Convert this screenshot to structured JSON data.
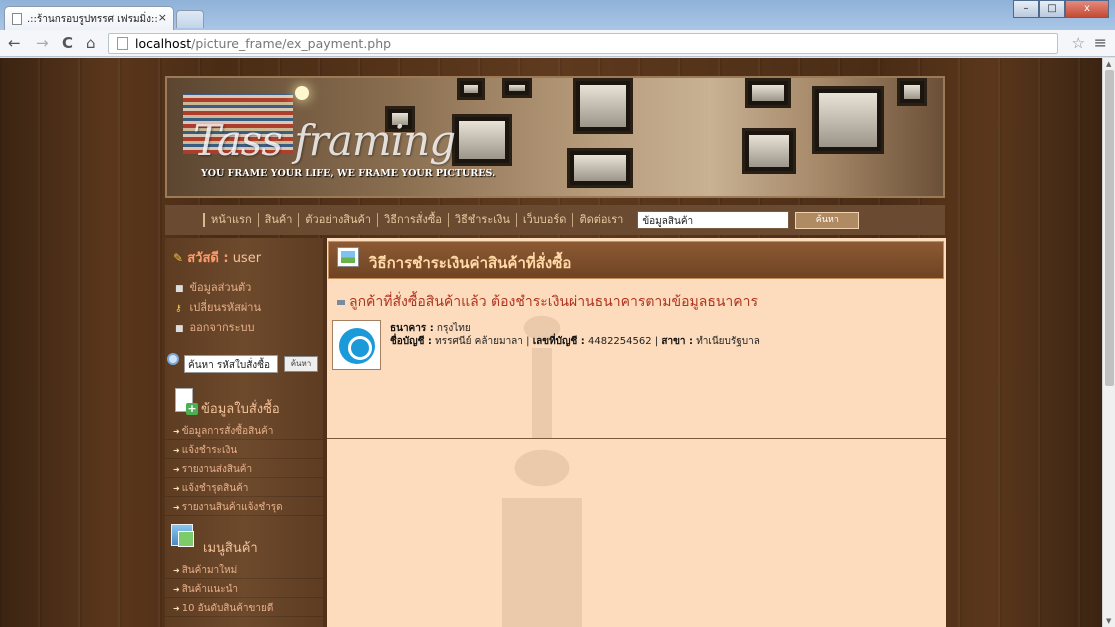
{
  "browser": {
    "tab_title": ".::ร้านกรอบรูปทรรศ เฟรมมิ่ง::",
    "tab_close": "×",
    "url_host": "localhost",
    "url_path": "/picture_frame/ex_payment.php",
    "back": "←",
    "forward": "→",
    "reload": "C",
    "home": "⌂",
    "star": "☆",
    "menu": "≡",
    "win_min": "–",
    "win_max": "□",
    "win_close": "x"
  },
  "banner": {
    "brand": "Tass framing",
    "tagline": "YOU FRAME YOUR LIFE, WE FRAME YOUR PICTURES."
  },
  "nav": {
    "items": [
      "หน้าแรก",
      "สินค้า",
      "ตัวอย่างสินค้า",
      "วิธีการสั่งซื้อ",
      "วิธีชำระเงิน",
      "เว็บบอร์ด",
      "ติดต่อเรา"
    ],
    "search_value": "ข้อมูลสินค้า",
    "search_button": "ค้นหา"
  },
  "sidebar": {
    "greeting_prefix": "สวัสดี :",
    "username": "user",
    "links": [
      "ข้อมูลส่วนตัว",
      "เปลี่ยนรหัสผ่าน",
      "ออกจากระบบ"
    ],
    "order_search_value": "ค้นหา รหัสใบสั่งซื้อ",
    "order_search_button": "ค้นหา",
    "order_section_title": "ข้อมูลใบสั่งซื้อ",
    "order_items": [
      "ข้อมูลการสั่งซื้อสินค้า",
      "แจ้งชำระเงิน",
      "รายงานส่งสินค้า",
      "แจ้งชำรุดสินค้า",
      "รายงานสินค้าแจ้งชำรุด"
    ],
    "product_section_title": "เมนูสินค้า",
    "product_items": [
      "สินค้ามาใหม่",
      "สินค้าแนะนำ",
      "10 อันดับสินค้าขายดี"
    ]
  },
  "content": {
    "title": "วิธีการชำระเงินค่าสินค้าที่สั่งซื้อ",
    "subtitle": "ลูกค้าที่สั่งซื้อสินค้าแล้ว ต้องชำระเงินผ่านธนาคารตามข้อมูลธนาคาร",
    "bank_label": "ธนาคาร :",
    "bank_name": "กรุงไทย",
    "account_name_label": "ชื่อบัญชี :",
    "account_name": "ทรรศนีย์ คล้ายมาลา",
    "account_no_label": "เลขที่บัญชี :",
    "account_no": "4482254562",
    "branch_label": "สาขา :",
    "branch": "ทำเนียบรัฐบาล",
    "separator": "|"
  },
  "colors": {
    "content_bg": "#fddcbd",
    "header_brown": "#7a4a28",
    "accent_red": "#b0331f",
    "bank_blue": "#1a9ad8"
  }
}
